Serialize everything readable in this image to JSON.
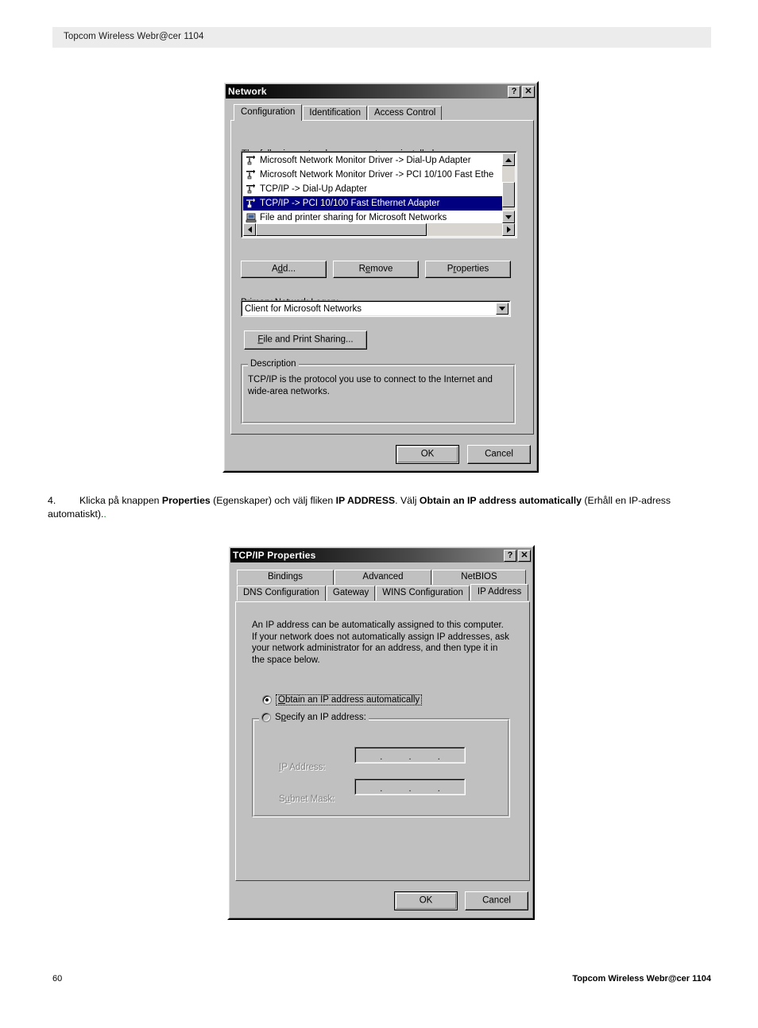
{
  "page": {
    "header_title": "Topcom Wireless Webr@cer 1104",
    "footer_page_number": "60",
    "footer_title": "Topcom Wireless Webr@cer 1104"
  },
  "instruction": {
    "number": "4.",
    "part1": "Klicka på knappen ",
    "bold1": "Properties",
    "part2": " (Egenskaper) och välj fliken ",
    "bold2": "IP ADDRESS",
    "part3": ". Välj ",
    "bold3": "Obtain an IP address automatically",
    "part4": " (Erhåll en IP-adress automatiskt).",
    "trailing_dot": "."
  },
  "network_dialog": {
    "title": "Network",
    "help_button": "?",
    "close_button": "✕",
    "tabs": [
      {
        "label": "Configuration",
        "active": true
      },
      {
        "label": "Identification",
        "active": false
      },
      {
        "label": "Access Control",
        "active": false
      }
    ],
    "list_label_pre": "The following ",
    "list_label_underlined": "n",
    "list_label_post": "etwork components are installed:",
    "components": [
      {
        "text": "Microsoft Network Monitor Driver -> Dial-Up Adapter",
        "icon": "network-protocol-icon",
        "selected": false
      },
      {
        "text": "Microsoft Network Monitor Driver -> PCI 10/100 Fast Ethe",
        "icon": "network-protocol-icon",
        "selected": false
      },
      {
        "text": "TCP/IP -> Dial-Up Adapter",
        "icon": "network-protocol-icon",
        "selected": false
      },
      {
        "text": "TCP/IP -> PCI 10/100 Fast Ethernet Adapter",
        "icon": "network-protocol-icon",
        "selected": true
      },
      {
        "text": "File and printer sharing for Microsoft Networks",
        "icon": "file-printer-sharing-icon",
        "selected": false
      }
    ],
    "buttons": {
      "add": {
        "pre": "A",
        "u": "d",
        "post": "d..."
      },
      "remove": {
        "pre": "R",
        "u": "e",
        "post": "move"
      },
      "properties": {
        "pre": "P",
        "u": "r",
        "post": "operties"
      }
    },
    "primary_logon_label_pre": "Primary Network ",
    "primary_logon_label_u": "L",
    "primary_logon_label_post": "ogon:",
    "primary_logon_value": "Client for Microsoft Networks",
    "file_print_sharing": {
      "pre": "",
      "u": "F",
      "post": "ile and Print Sharing..."
    },
    "description_group_title": "Description",
    "description_text": "TCP/IP is the protocol you use to connect to the Internet and wide-area networks.",
    "ok_label": "OK",
    "cancel_label": "Cancel"
  },
  "tcpip_dialog": {
    "title": "TCP/IP Properties",
    "help_button": "?",
    "close_button": "✕",
    "tabs_row1": [
      {
        "label": "Bindings",
        "active": false
      },
      {
        "label": "Advanced",
        "active": false
      },
      {
        "label": "NetBIOS",
        "active": false
      }
    ],
    "tabs_row2": [
      {
        "label": "DNS Configuration",
        "active": false
      },
      {
        "label": "Gateway",
        "active": false
      },
      {
        "label": "WINS Configuration",
        "active": false
      },
      {
        "label": "IP Address",
        "active": true
      }
    ],
    "info_text": "An IP address can be automatically assigned to this computer.\nIf your network does not automatically assign IP addresses, ask\nyour network administrator for an address, and then type it in\nthe space below.",
    "radio_obtain": {
      "u": "O",
      "post": "btain an IP address automatically",
      "checked": true
    },
    "radio_specify": {
      "pre": "S",
      "u": "p",
      "post": "ecify an IP address:",
      "checked": false
    },
    "ip_address_label": {
      "u": "I",
      "post": "P Address:"
    },
    "subnet_mask_label": {
      "pre": "S",
      "u": "u",
      "post": "bnet Mask:"
    },
    "ip_address_value": "",
    "subnet_mask_value": "",
    "ip_separator": ".",
    "ok_label": "OK",
    "cancel_label": "Cancel"
  }
}
